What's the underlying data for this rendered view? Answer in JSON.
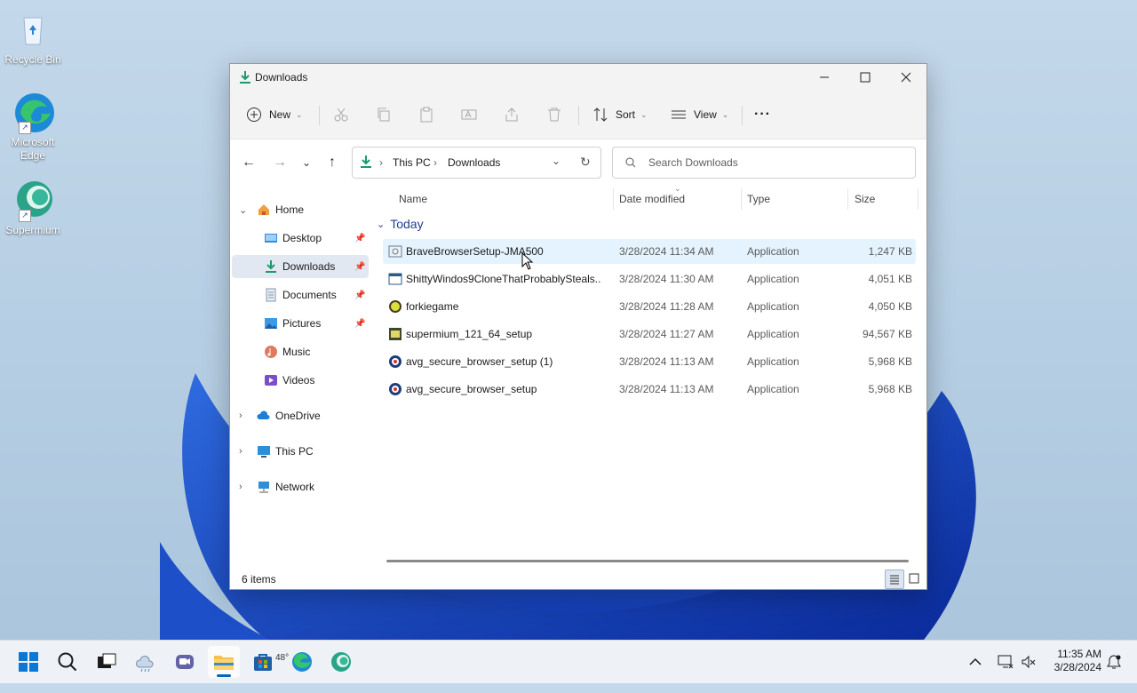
{
  "desktop": {
    "icons": [
      {
        "label": "Recycle Bin",
        "icon": "recycle-bin-icon"
      },
      {
        "label": "Microsoft Edge",
        "icon": "edge-icon"
      },
      {
        "label": "Supermium",
        "icon": "supermium-icon"
      }
    ]
  },
  "window": {
    "title": "Downloads",
    "controls": {
      "minimize": "minimize-icon",
      "maximize": "maximize-icon",
      "close": "close-icon"
    }
  },
  "toolbar": {
    "new_label": "New",
    "sort_label": "Sort",
    "view_label": "View",
    "more_label": "···"
  },
  "address": {
    "crumbs": [
      "This PC",
      "Downloads"
    ]
  },
  "search": {
    "placeholder": "Search Downloads"
  },
  "sidebar": {
    "items": [
      {
        "label": "Home",
        "icon": "home-icon"
      },
      {
        "label": "Desktop",
        "icon": "desktop-folder-icon",
        "pinned": true
      },
      {
        "label": "Downloads",
        "icon": "downloads-icon",
        "pinned": true,
        "selected": true
      },
      {
        "label": "Documents",
        "icon": "documents-icon",
        "pinned": true
      },
      {
        "label": "Pictures",
        "icon": "pictures-icon",
        "pinned": true
      },
      {
        "label": "Music",
        "icon": "music-icon"
      },
      {
        "label": "Videos",
        "icon": "videos-icon"
      },
      {
        "label": "OneDrive",
        "icon": "onedrive-icon"
      },
      {
        "label": "This PC",
        "icon": "this-pc-icon"
      },
      {
        "label": "Network",
        "icon": "network-icon"
      }
    ]
  },
  "columns": {
    "name": "Name",
    "date": "Date modified",
    "type": "Type",
    "size": "Size"
  },
  "group": {
    "label": "Today"
  },
  "files": [
    {
      "name": "BraveBrowserSetup-JMA500",
      "date": "3/28/2024 11:34 AM",
      "type": "Application",
      "size": "1,247 KB"
    },
    {
      "name": "ShittyWindos9CloneThatProbablySteals...",
      "date": "3/28/2024 11:30 AM",
      "type": "Application",
      "size": "4,051 KB"
    },
    {
      "name": "forkiegame",
      "date": "3/28/2024 11:28 AM",
      "type": "Application",
      "size": "4,050 KB"
    },
    {
      "name": "supermium_121_64_setup",
      "date": "3/28/2024 11:27 AM",
      "type": "Application",
      "size": "94,567 KB"
    },
    {
      "name": "avg_secure_browser_setup (1)",
      "date": "3/28/2024 11:13 AM",
      "type": "Application",
      "size": "5,968 KB"
    },
    {
      "name": "avg_secure_browser_setup",
      "date": "3/28/2024 11:13 AM",
      "type": "Application",
      "size": "5,968 KB"
    }
  ],
  "status": {
    "item_count": "6 items"
  },
  "taskbar": {
    "weather_temp": "48°",
    "clock_time": "11:35 AM",
    "clock_date": "3/28/2024"
  },
  "colors": {
    "accent": "#0067c0",
    "selection": "#e1e8f1",
    "hover": "#e5f3ff"
  }
}
